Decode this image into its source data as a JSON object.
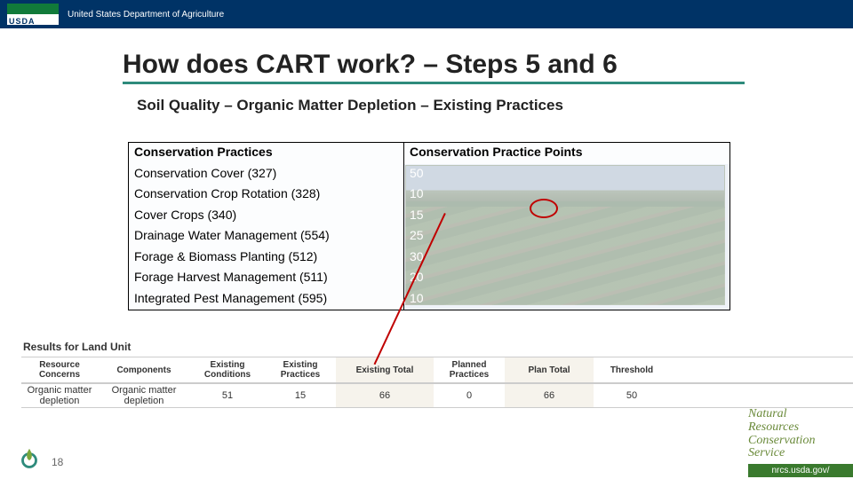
{
  "header": {
    "usda": "USDA",
    "dept": "United States Department of Agriculture"
  },
  "title": "How does CART work? – Steps 5 and 6",
  "subtitle": "Soil Quality – Organic Matter Depletion – Existing Practices",
  "practice_table": {
    "col_left_header": "Conservation Practices",
    "col_right_header": "Conservation Practice Points",
    "rows": [
      {
        "name": "Conservation Cover (327)",
        "points": "50"
      },
      {
        "name": "Conservation Crop Rotation (328)",
        "points": "10"
      },
      {
        "name": "Cover Crops (340)",
        "points": "15"
      },
      {
        "name": "Drainage Water Management (554)",
        "points": "25"
      },
      {
        "name": "Forage & Biomass Planting (512)",
        "points": "30"
      },
      {
        "name": "Forage Harvest Management (511)",
        "points": "20"
      },
      {
        "name": "Integrated Pest Management (595)",
        "points": "10"
      }
    ]
  },
  "results": {
    "title": "Results for Land Unit",
    "headers": {
      "resource": "Resource Concerns",
      "components": "Components",
      "existing_cond": "Existing Conditions",
      "existing_prac": "Existing Practices",
      "existing_total": "Existing Total",
      "planned": "Planned Practices",
      "plan_total": "Plan Total",
      "threshold": "Threshold"
    },
    "row": {
      "resource": "Organic matter depletion",
      "components": "Organic matter depletion",
      "existing_cond": "51",
      "existing_prac": "15",
      "existing_total": "66",
      "planned": "0",
      "plan_total": "66",
      "threshold": "50"
    }
  },
  "footer": {
    "nrcs_lines": [
      "Natural",
      "Resources",
      "Conservation",
      "Service"
    ],
    "link": "nrcs.usda.gov/"
  },
  "slide_number": "18",
  "chart_data": {
    "type": "table",
    "title": "Results for Land Unit",
    "columns": [
      "Resource Concerns",
      "Components",
      "Existing Conditions",
      "Existing Practices",
      "Existing Total",
      "Planned Practices",
      "Plan Total",
      "Threshold"
    ],
    "rows": [
      [
        "Organic matter depletion",
        "Organic matter depletion",
        51,
        15,
        66,
        0,
        66,
        50
      ]
    ]
  }
}
